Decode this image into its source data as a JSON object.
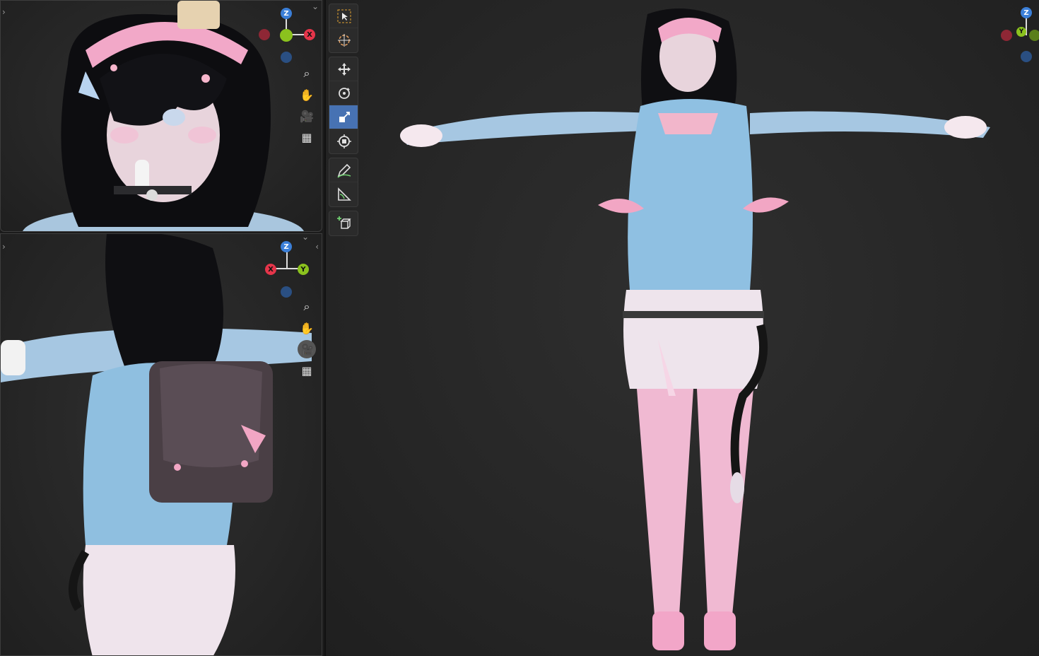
{
  "viewports": {
    "top_left": {
      "gizmo": {
        "z": "Z",
        "x": "X"
      },
      "nav": [
        "zoom-icon",
        "pan-hand-icon",
        "camera-icon",
        "grid-icon"
      ]
    },
    "bottom_left": {
      "gizmo": {
        "z": "Z",
        "x": "X",
        "y": "Y"
      },
      "nav": [
        "zoom-icon",
        "pan-hand-icon",
        "camera-icon",
        "grid-icon"
      ]
    },
    "main": {
      "gizmo": {
        "z": "Z",
        "y": "Y"
      }
    }
  },
  "toolbar": {
    "groups": [
      [
        "select-box-tool",
        "cursor-tool"
      ],
      [
        "move-tool",
        "rotate-tool",
        "scale-tool",
        "transform-tool"
      ],
      [
        "annotate-tool",
        "measure-tool"
      ],
      [
        "add-cube-tool"
      ]
    ],
    "active": "scale-tool"
  },
  "colors": {
    "axis_x": "#e5354a",
    "axis_y": "#8bc21e",
    "axis_z": "#3b7fd8",
    "active_tool": "#4772b3",
    "background": "#262626"
  }
}
